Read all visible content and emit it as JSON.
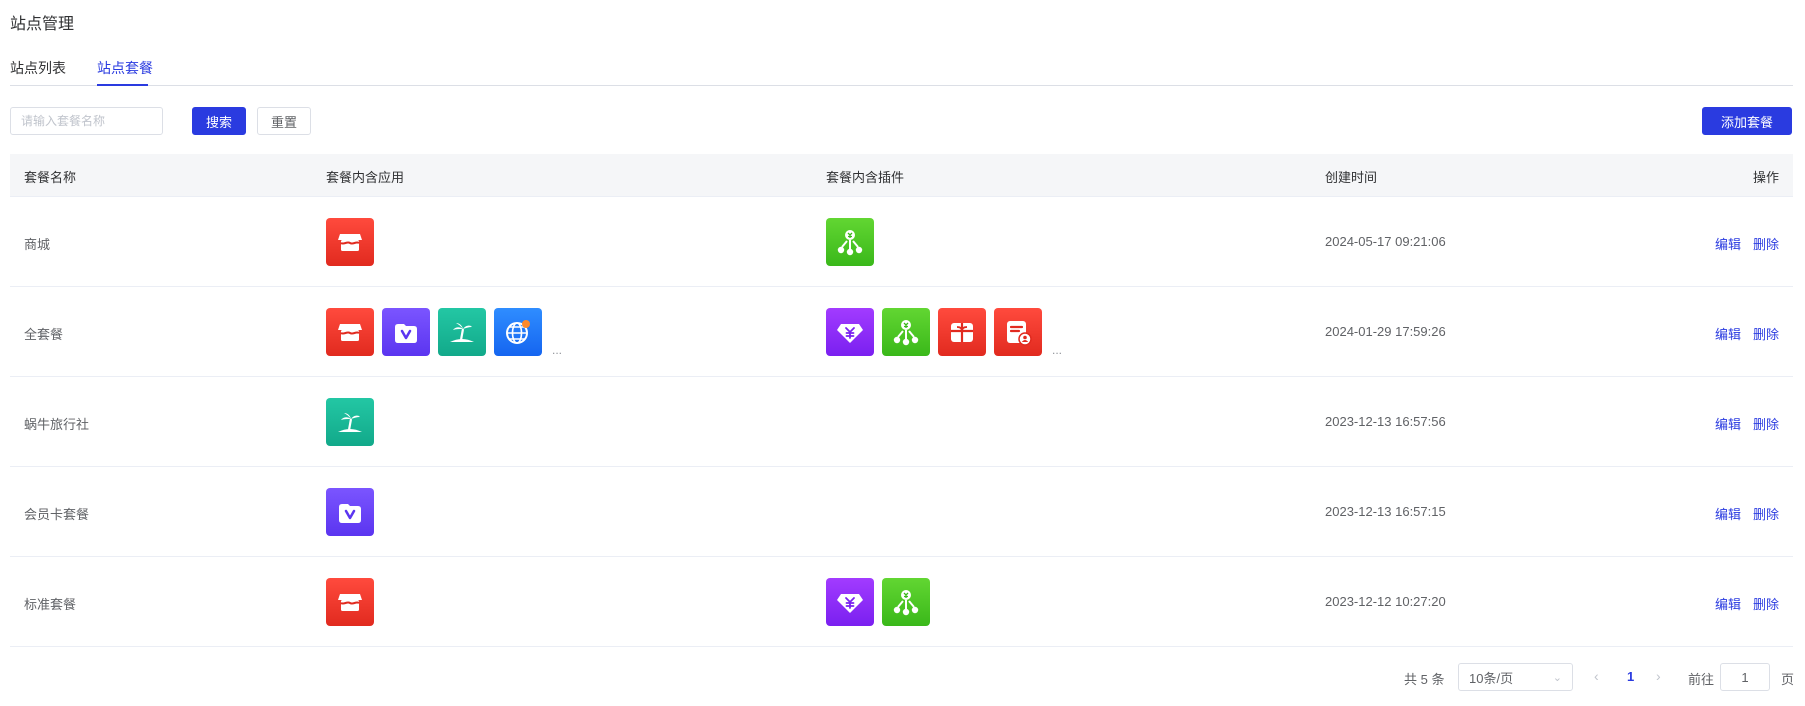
{
  "page_title": "站点管理",
  "tabs": [
    {
      "label": "站点列表",
      "active": false
    },
    {
      "label": "站点套餐",
      "active": true
    }
  ],
  "search": {
    "placeholder": "请输入套餐名称",
    "value": ""
  },
  "buttons": {
    "search": "搜索",
    "reset": "重置",
    "add": "添加套餐"
  },
  "table": {
    "headers": {
      "name": "套餐名称",
      "apps": "套餐内含应用",
      "plugins": "套餐内含插件",
      "created": "创建时间",
      "ops": "操作"
    },
    "rows": [
      {
        "name": "商城",
        "apps": [
          "store"
        ],
        "apps_more": "",
        "plugins": [
          "distribution"
        ],
        "plugins_more": "",
        "created": "2024-05-17 09:21:06",
        "edit": "编辑",
        "delete": "删除"
      },
      {
        "name": "全套餐",
        "apps": [
          "store",
          "member-card",
          "travel",
          "global"
        ],
        "apps_more": "...",
        "plugins": [
          "price-gem",
          "distribution",
          "gift-card",
          "user-form"
        ],
        "plugins_more": "...",
        "created": "2024-01-29 17:59:26",
        "edit": "编辑",
        "delete": "删除"
      },
      {
        "name": "蜗牛旅行社",
        "apps": [
          "travel"
        ],
        "apps_more": "",
        "plugins": [],
        "plugins_more": "",
        "created": "2023-12-13 16:57:56",
        "edit": "编辑",
        "delete": "删除"
      },
      {
        "name": "会员卡套餐",
        "apps": [
          "member-card"
        ],
        "apps_more": "",
        "plugins": [],
        "plugins_more": "",
        "created": "2023-12-13 16:57:15",
        "edit": "编辑",
        "delete": "删除"
      },
      {
        "name": "标准套餐",
        "apps": [
          "store"
        ],
        "apps_more": "",
        "plugins": [
          "price-gem",
          "distribution"
        ],
        "plugins_more": "",
        "created": "2023-12-12 10:27:20",
        "edit": "编辑",
        "delete": "删除"
      }
    ]
  },
  "pagination": {
    "total": "共 5 条",
    "page_size": "10条/页",
    "current_page": "1",
    "goto_label": "前往",
    "goto_value": "1",
    "unit": "页"
  },
  "colors": {
    "primary": "#2a3be0",
    "header_bg": "#f5f6f8"
  }
}
